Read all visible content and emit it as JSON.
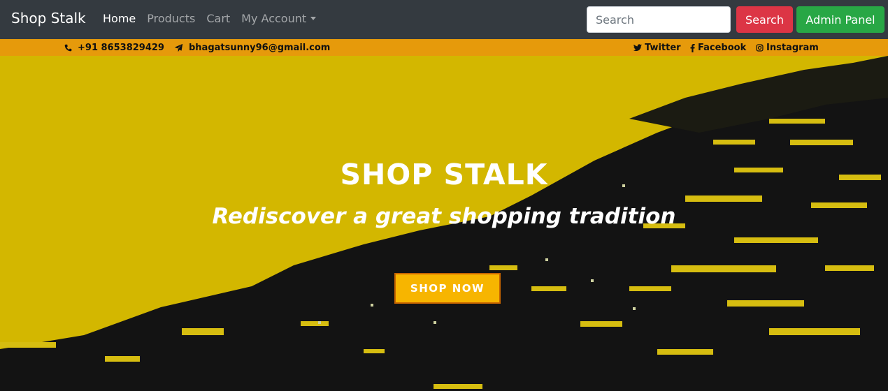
{
  "navbar": {
    "brand": "Shop Stalk",
    "links": [
      {
        "label": "Home"
      },
      {
        "label": "Products"
      },
      {
        "label": "Cart"
      },
      {
        "label": "My Account"
      }
    ],
    "search": {
      "placeholder": "Search",
      "value": ""
    },
    "search_button": "Search",
    "admin_button": "Admin Panel"
  },
  "topbar": {
    "phone": "+91 8653829429",
    "email": "bhagatsunny96@gmail.com",
    "social": [
      {
        "label": "Twitter",
        "icon": "twitter-icon"
      },
      {
        "label": "Facebook",
        "icon": "facebook-icon"
      },
      {
        "label": "Instagram",
        "icon": "instagram-icon"
      }
    ],
    "background": "#e69a0b"
  },
  "hero": {
    "title": "SHOP STALK",
    "tagline": "Rediscover a great shopping tradition",
    "cta": "SHOP NOW",
    "background_colors": [
      "#d4b800",
      "#121212"
    ],
    "cta_color": "#f7b500"
  }
}
